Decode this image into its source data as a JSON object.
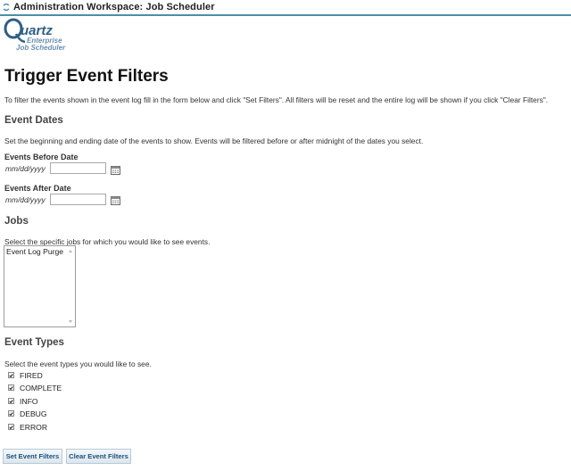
{
  "window": {
    "title": "Administration Workspace: Job Scheduler"
  },
  "logo": {
    "brand": "Quartz",
    "line1": "Enterprise",
    "line2": "Job Scheduler"
  },
  "page": {
    "title": "Trigger Event Filters",
    "intro": "To filter the events shown in the event log fill in the form below and click \"Set Filters\". All filters will be reset and the entire log will be shown if you click \"Clear Filters\"."
  },
  "event_dates": {
    "heading": "Event Dates",
    "description": "Set the beginning and ending date of the events to show. Events will be filtered before or after midnight of the dates you select.",
    "before": {
      "label": "Events Before Date",
      "hint": "mm/dd/yyyy",
      "value": ""
    },
    "after": {
      "label": "Events After Date",
      "hint": "mm/dd/yyyy",
      "value": ""
    }
  },
  "jobs": {
    "heading": "Jobs",
    "description": "Select the specific jobs for which you would like to see events.",
    "options": [
      "Event Log Purge"
    ]
  },
  "event_types": {
    "heading": "Event Types",
    "description": "Select the event types you would like to see.",
    "items": [
      {
        "label": "FIRED",
        "checked": true
      },
      {
        "label": "COMPLETE",
        "checked": true
      },
      {
        "label": "INFO",
        "checked": true
      },
      {
        "label": "DEBUG",
        "checked": true
      },
      {
        "label": "ERROR",
        "checked": true
      }
    ]
  },
  "buttons": {
    "set": "Set Event Filters",
    "clear": "Clear Event Filters"
  },
  "colors": {
    "accent": "#4a90a8",
    "logo_blue": "#2f5f86",
    "button_text": "#1e4f7a"
  },
  "icons": {
    "workspace": "gear-icon",
    "calendar": "calendar-icon",
    "checkmark": "checkmark-icon"
  }
}
